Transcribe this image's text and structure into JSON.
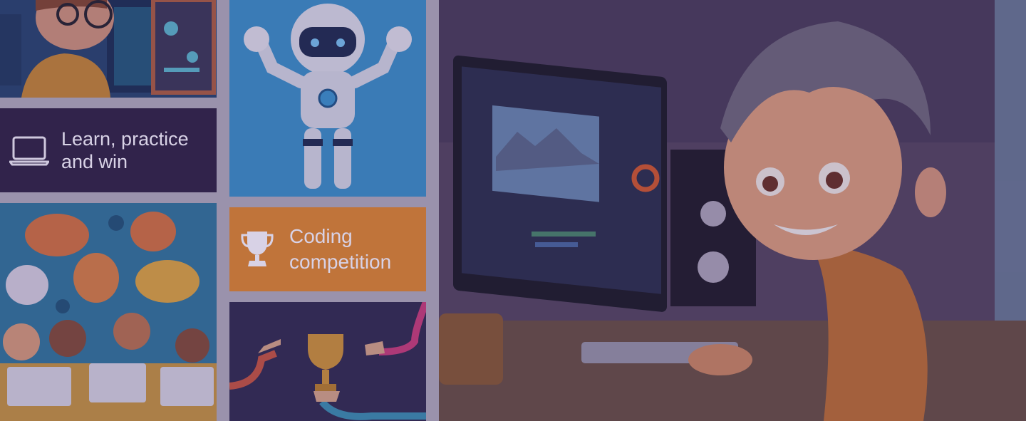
{
  "tiles": {
    "learn": {
      "label": "Learn, practice and win",
      "icon": "laptop-icon"
    },
    "coding": {
      "label": "Coding competition",
      "icon": "trophy-icon"
    }
  },
  "images": {
    "kid_glasses": "illustration of boy with glasses at screens",
    "robot": "white and blue robot waving",
    "kids_chat": "kids at computers with speech bubbles",
    "hands_trophy": "hands passing golden trophy",
    "hero": "smiling boy at computer with video editor"
  },
  "colors": {
    "dark_purple": "#31234b",
    "orange": "#c0743a",
    "robot_bg": "#3aa0d8",
    "navy": "#2f2c4a",
    "separator": "#9a92ac"
  }
}
